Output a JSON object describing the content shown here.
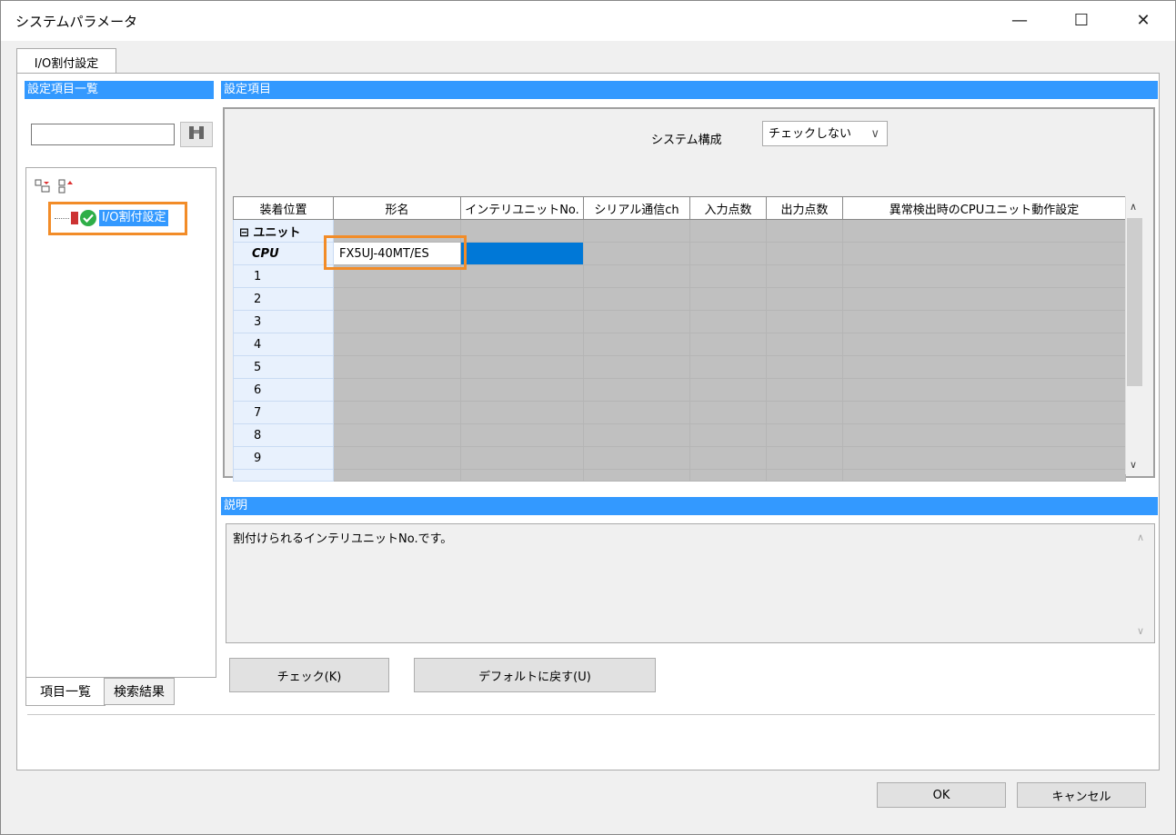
{
  "window": {
    "title": "システムパラメータ",
    "minimize": "—",
    "maximize": "☐",
    "close": "✕"
  },
  "tabs": {
    "main": "I/O割付設定"
  },
  "left": {
    "header": "設定項目一覧",
    "search_value": "",
    "tree_item": "I/O割付設定",
    "bottom_tabs": [
      "項目一覧",
      "検索結果"
    ]
  },
  "settings": {
    "header": "設定項目",
    "system_label": "システム構成",
    "system_value": "チェックしない"
  },
  "grid": {
    "columns": [
      "装着位置",
      "形名",
      "インテリユニットNo.",
      "シリアル通信ch",
      "入力点数",
      "出力点数",
      "異常検出時のCPUユニット動作設定"
    ],
    "rows": [
      {
        "pos": "⊟ ユニット",
        "model": ""
      },
      {
        "pos": "CPU",
        "model": "FX5UJ-40MT/ES"
      },
      {
        "pos": "1",
        "model": ""
      },
      {
        "pos": "2",
        "model": ""
      },
      {
        "pos": "3",
        "model": ""
      },
      {
        "pos": "4",
        "model": ""
      },
      {
        "pos": "5",
        "model": ""
      },
      {
        "pos": "6",
        "model": ""
      },
      {
        "pos": "7",
        "model": ""
      },
      {
        "pos": "8",
        "model": ""
      },
      {
        "pos": "9",
        "model": ""
      },
      {
        "pos": "",
        "model": ""
      }
    ]
  },
  "description": {
    "header": "説明",
    "text": "割付けられるインテリユニットNo.です。"
  },
  "buttons": {
    "check": "チェック(K)",
    "default": "デフォルトに戻す(U)",
    "ok": "OK",
    "cancel": "キャンセル"
  },
  "colors": {
    "accent": "#3399ff",
    "highlight": "#f28c28",
    "cell": "#c0c0c0",
    "selected": "#0078d7"
  }
}
